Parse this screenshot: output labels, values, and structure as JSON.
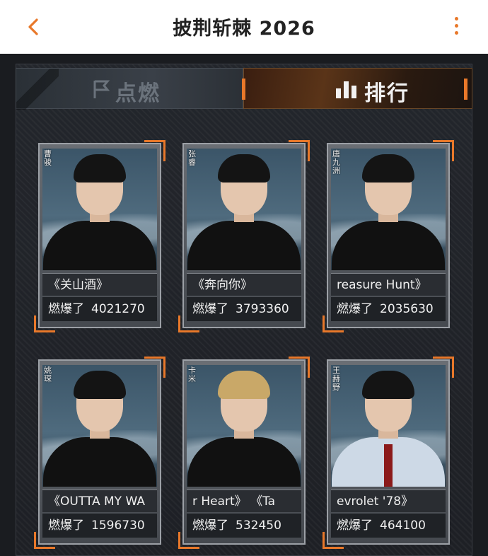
{
  "header": {
    "title": "披荆斩棘 2026",
    "back_icon": "chevron-left-icon",
    "more_icon": "more-vertical-icon",
    "accent": "#e8782a"
  },
  "tabs": [
    {
      "label": "点燃",
      "icon": "flag-icon",
      "active": false
    },
    {
      "label": "排行",
      "icon": "bar-chart-icon",
      "active": true
    }
  ],
  "stat_label": "燃爆了",
  "cards": [
    {
      "name": "曹骏",
      "song": "《关山酒》",
      "count": "4021270"
    },
    {
      "name": "张睿",
      "song": "《奔向你》",
      "count": "3793360"
    },
    {
      "name": "唐九洲",
      "song": "reasure Hunt》",
      "count": "2035630"
    },
    {
      "name": "姚琛",
      "song": "《OUTTA MY WA",
      "count": "1596730"
    },
    {
      "name": "卡米",
      "song": "r Heart》     《Ta",
      "count": "532450"
    },
    {
      "name": "王赫野",
      "song": "evrolet '78》",
      "count": "464100"
    }
  ]
}
